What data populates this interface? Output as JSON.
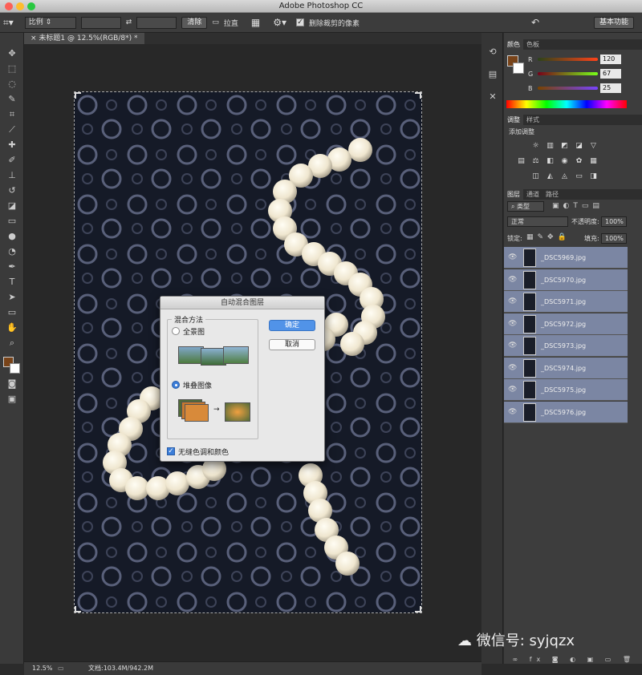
{
  "app": {
    "title": "Adobe Photoshop CC"
  },
  "options": {
    "ratio": "比例",
    "clear": "清除",
    "straighten": "拉直",
    "delete_crop": "删除裁剪的像素",
    "workspace": "基本功能"
  },
  "document": {
    "tab": "未标题1 @ 12.5%(RGB/8*) *"
  },
  "status": {
    "zoom": "12.5%",
    "doc": "文档:103.4M/942.2M"
  },
  "dialog": {
    "title": "自动混合图层",
    "group": "混合方法",
    "option1": "全景图",
    "option2": "堆叠图像",
    "ok": "确定",
    "cancel": "取消",
    "seamless": "无缝色调和颜色"
  },
  "color_panel": {
    "tabs": [
      "颜色",
      "色板"
    ],
    "r_label": "R",
    "g_label": "G",
    "b_label": "B",
    "r": "120",
    "g": "67",
    "b": "25",
    "fg_color": "#784319"
  },
  "adjust_panel": {
    "tabs": [
      "调整",
      "样式"
    ],
    "title": "添加调整"
  },
  "layers_panel": {
    "tabs": [
      "图层",
      "通道",
      "路径"
    ],
    "kind": "类型",
    "blend": "正常",
    "opacity_label": "不透明度:",
    "opacity": "100%",
    "lock_label": "锁定:",
    "fill_label": "填充:",
    "fill": "100%",
    "layers": [
      "_DSC5969.jpg",
      "_DSC5970.jpg",
      "_DSC5971.jpg",
      "_DSC5972.jpg",
      "_DSC5973.jpg",
      "_DSC5974.jpg",
      "_DSC5975.jpg",
      "_DSC5976.jpg"
    ]
  },
  "watermark": "微信号: syjqzx"
}
